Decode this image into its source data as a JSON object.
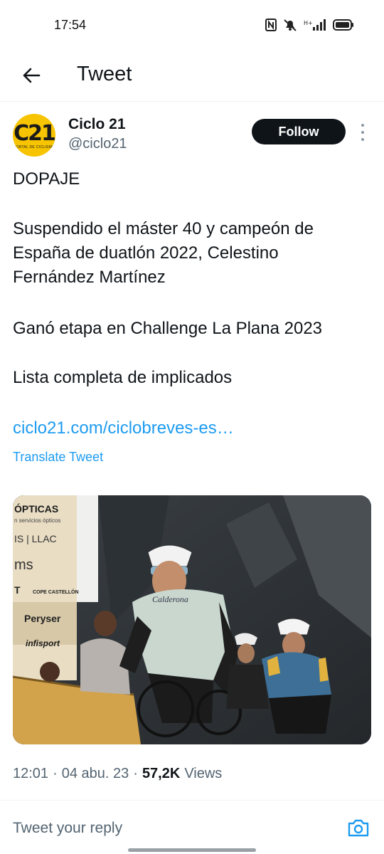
{
  "status_bar": {
    "time": "17:54"
  },
  "header": {
    "title": "Tweet"
  },
  "author": {
    "avatar_logo": "C21",
    "avatar_subtext": "PORTAL DE CICLISMO",
    "display_name": "Ciclo 21",
    "handle": "@ciclo21",
    "follow_label": "Follow"
  },
  "tweet": {
    "paragraphs": [
      "DOPAJE",
      "Suspendido el máster 40 y campeón de España de duatlón 2022, Celestino Fernández Martínez",
      "Ganó etapa en Challenge La Plana 2023",
      "Lista completa de implicados"
    ],
    "link": "ciclo21.com/ciclobreves-es…",
    "translate_label": "Translate Tweet"
  },
  "media": {
    "signs": [
      "ÓPTICAS",
      "n servicios ópticos",
      "IS | LLAC",
      "ms",
      "T",
      "COPE CASTELLÓN",
      "Peryser",
      "infisport",
      "Calderona"
    ]
  },
  "meta": {
    "time": "12:01",
    "date": "04 abu. 23",
    "views_count": "57,2K",
    "views_label": "Views",
    "separator": "·"
  },
  "reply": {
    "placeholder": "Tweet your reply"
  },
  "colors": {
    "accent": "#1d9bf0",
    "text": "#0f1419",
    "muted": "#536471",
    "follow_bg": "#0f1419",
    "avatar_bg": "#f6c400"
  }
}
